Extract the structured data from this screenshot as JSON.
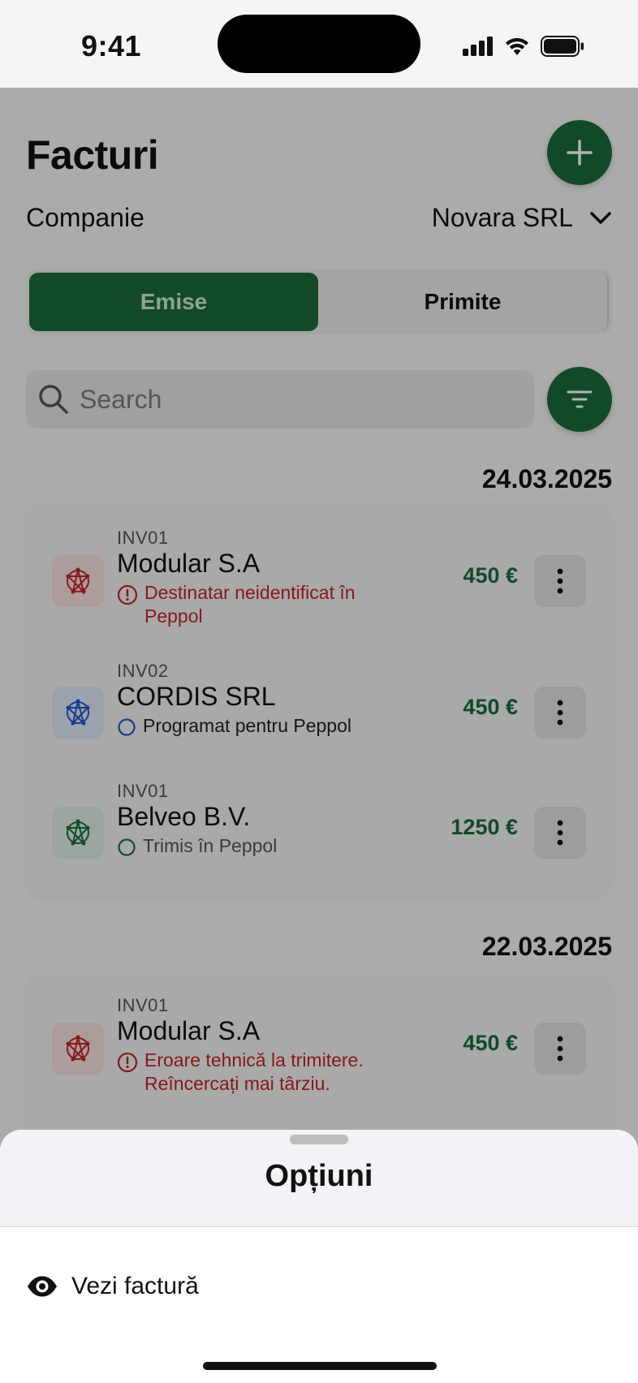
{
  "status_bar": {
    "time": "9:41"
  },
  "header": {
    "title": "Facturi",
    "add_icon": "plus-icon"
  },
  "company": {
    "label": "Companie",
    "selected": "Novara SRL"
  },
  "tabs": [
    {
      "label": "Emise",
      "active": true
    },
    {
      "label": "Primite",
      "active": false
    }
  ],
  "search": {
    "placeholder": "Search"
  },
  "groups": [
    {
      "date": "24.03.2025",
      "invoices": [
        {
          "number": "INV01",
          "name": "Modular S.A",
          "status": "Destinatar neidentificat în\nPeppol",
          "status_type": "error",
          "amount": "450 €"
        },
        {
          "number": "INV02",
          "name": "CORDIS SRL",
          "status": "Programat pentru Peppol",
          "status_type": "scheduled",
          "amount": "450 €"
        },
        {
          "number": "INV01",
          "name": "Belveo B.V.",
          "status": "Trimis în Peppol",
          "status_type": "sent",
          "amount": "1250 €"
        }
      ]
    },
    {
      "date": "22.03.2025",
      "invoices": [
        {
          "number": "INV01",
          "name": "Modular S.A",
          "status": "Eroare tehnică la trimitere.\nReîncercați mai târziu.",
          "status_type": "error",
          "amount": "450 €"
        }
      ]
    }
  ],
  "sheet": {
    "title": "Opțiuni",
    "options": [
      {
        "label": "Vezi factură",
        "icon": "eye-icon"
      }
    ]
  },
  "colors": {
    "brand_green": "#1a6b3c",
    "error_red": "#c0242b",
    "scheduled_blue": "#2456c8",
    "sent_green": "#1d6b3e"
  }
}
